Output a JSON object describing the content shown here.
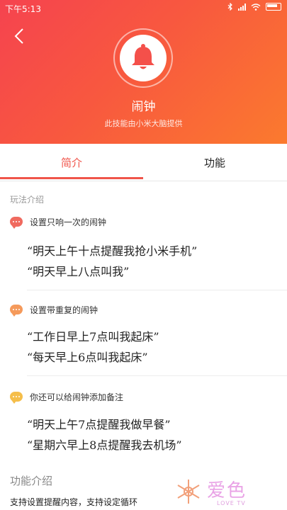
{
  "status_bar": {
    "time": "下午5:13"
  },
  "header": {
    "icon": "bell-icon",
    "title": "闹钟",
    "provider": "此技能由小米大脑提供",
    "gradient_start": "#f5434f",
    "gradient_end": "#fb7a2e"
  },
  "tabs": [
    {
      "label": "简介",
      "active": true
    },
    {
      "label": "功能",
      "active": false
    }
  ],
  "accent_color": "#f0544a",
  "intro": {
    "section_label": "玩法介绍",
    "skills": [
      {
        "title": "设置只响一次的闹钟",
        "bubble_color": "#f06a5f",
        "examples": [
          "“明天上午十点提醒我抢小米手机”",
          "“明天早上八点叫我”"
        ]
      },
      {
        "title": "设置带重复的闹钟",
        "bubble_color": "#f59a5b",
        "examples": [
          "“工作日早上7点叫我起床”",
          "“每天早上6点叫我起床”"
        ]
      },
      {
        "title": "你还可以给闹钟添加备注",
        "bubble_color": "#f5be4a",
        "examples": [
          "“明天上午7点提醒我做早餐”",
          "“星期六早上8点提醒我去机场”"
        ]
      }
    ]
  },
  "features": {
    "label": "功能介绍",
    "description": "支持设置提醒内容，支持设定循环"
  },
  "watermark": {
    "brand": "爱色",
    "sub": "LOVE TV"
  }
}
